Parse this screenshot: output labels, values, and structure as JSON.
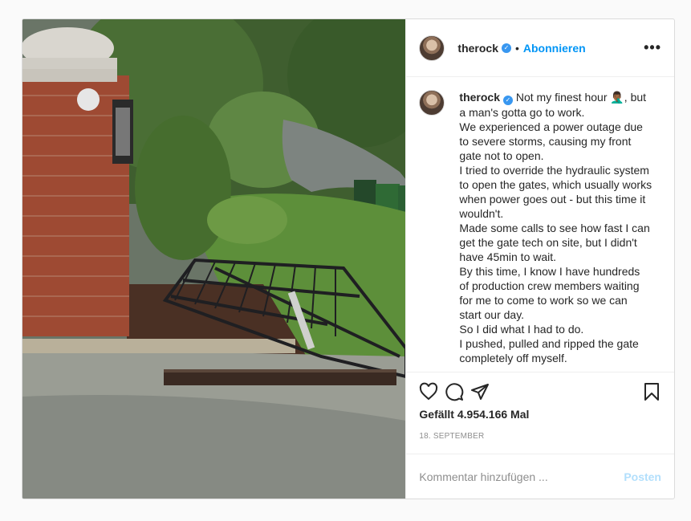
{
  "post": {
    "username": "therock",
    "follow_label": "Abonnieren",
    "more_label": "•••",
    "caption_lines": [
      "Not my finest hour 🤦🏾‍♂️, but a man's gotta go to work.",
      "We experienced a power outage due to severe storms, causing my front gate not to open.",
      "I tried to override the hydraulic system to open the gates, which usually works when power goes out - but this time it wouldn't.",
      "Made some calls to see how fast I can get the gate tech on site, but I didn't have 45min to wait.",
      "By this time, I know I have hundreds of production crew members waiting for me to come to work so we can start our day.",
      "So I did what I had to do.",
      "I pushed, pulled and ripped the gate completely off myself."
    ],
    "likes": "Gefällt 4.954.166 Mal",
    "date": "18. SEPTEMBER",
    "comment_placeholder": "Kommentar hinzufügen ...",
    "post_button": "Posten"
  },
  "colors": {
    "accent": "#0095f6",
    "verified": "#3897f0",
    "post_disabled": "#b2dffc"
  },
  "icons": [
    "verified-badge-icon",
    "heart-icon",
    "comment-icon",
    "share-icon",
    "bookmark-icon",
    "more-options-icon"
  ]
}
